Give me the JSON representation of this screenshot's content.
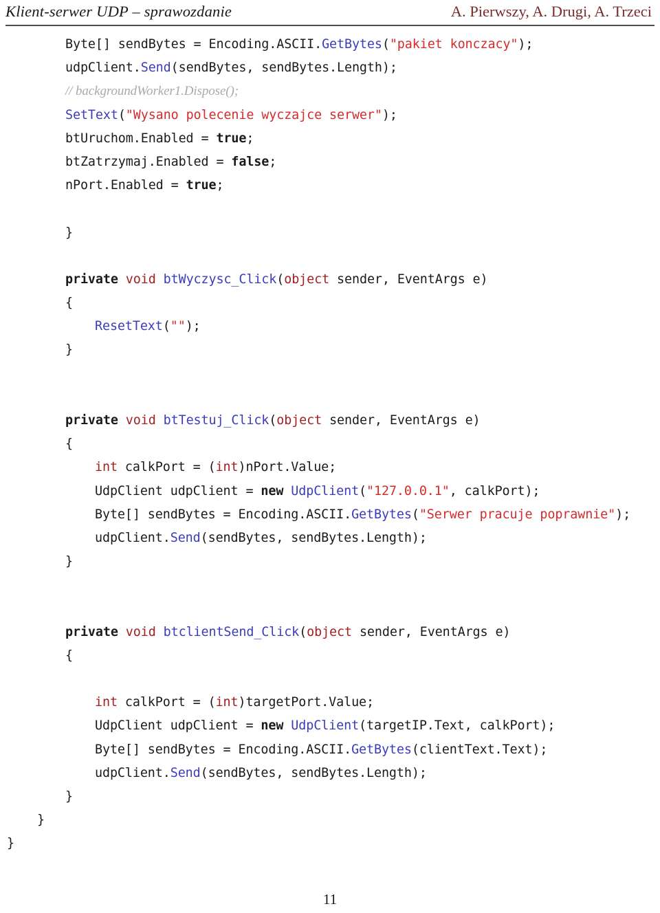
{
  "header": {
    "left_title": "Klient-serwer UDP – sprawozdanie",
    "right_authors": "A. Pierwszy, A. Drugi, A. Trzeci",
    "rule_color": "#4d4d4d",
    "authors_color": "#7a2b2b"
  },
  "footer": {
    "page_number": "11"
  },
  "colors": {
    "plain": "#1a1a1a",
    "keyword": "#1a1a1a",
    "type": "#a32020",
    "function": "#3b3bbd",
    "string": "#d42b2b",
    "comment": "#a9a9a9"
  },
  "code": {
    "lines": [
      {
        "indent": 2,
        "tokens": [
          {
            "t": "Byte[] sendBytes = Encoding.ASCII.",
            "c": "plain"
          },
          {
            "t": "GetBytes",
            "c": "function"
          },
          {
            "t": "(",
            "c": "plain"
          },
          {
            "t": "\"pakiet konczacy\"",
            "c": "string"
          },
          {
            "t": ");",
            "c": "plain"
          }
        ]
      },
      {
        "indent": 2,
        "tokens": [
          {
            "t": "udpClient.",
            "c": "plain"
          },
          {
            "t": "Send",
            "c": "function"
          },
          {
            "t": "(sendBytes, sendBytes.Length);",
            "c": "plain"
          }
        ]
      },
      {
        "indent": 2,
        "tokens": [
          {
            "t": "// backgroundWorker1.Dispose();",
            "c": "comment"
          }
        ]
      },
      {
        "indent": 2,
        "tokens": [
          {
            "t": "SetText",
            "c": "function"
          },
          {
            "t": "(",
            "c": "plain"
          },
          {
            "t": "\"Wysano polecenie wyczajce serwer\"",
            "c": "string"
          },
          {
            "t": ");",
            "c": "plain"
          }
        ]
      },
      {
        "indent": 2,
        "tokens": [
          {
            "t": "btUruchom.Enabled = ",
            "c": "plain"
          },
          {
            "t": "true",
            "c": "keyword"
          },
          {
            "t": ";",
            "c": "plain"
          }
        ]
      },
      {
        "indent": 2,
        "tokens": [
          {
            "t": "btZatrzymaj.Enabled = ",
            "c": "plain"
          },
          {
            "t": "false",
            "c": "keyword"
          },
          {
            "t": ";",
            "c": "plain"
          }
        ]
      },
      {
        "indent": 2,
        "tokens": [
          {
            "t": "nPort.Enabled = ",
            "c": "plain"
          },
          {
            "t": "true",
            "c": "keyword"
          },
          {
            "t": ";",
            "c": "plain"
          }
        ]
      },
      {
        "indent": 2,
        "tokens": [
          {
            "t": " ",
            "c": "plain"
          }
        ]
      },
      {
        "indent": 2,
        "tokens": [
          {
            "t": "}",
            "c": "plain"
          }
        ]
      },
      {
        "indent": 2,
        "tokens": [
          {
            "t": " ",
            "c": "plain"
          }
        ]
      },
      {
        "indent": 2,
        "tokens": [
          {
            "t": "private ",
            "c": "keyword"
          },
          {
            "t": "void",
            "c": "type"
          },
          {
            "t": " ",
            "c": "plain"
          },
          {
            "t": "btWyczysc_Click",
            "c": "function"
          },
          {
            "t": "(",
            "c": "plain"
          },
          {
            "t": "object",
            "c": "type"
          },
          {
            "t": " sender, EventArgs e)",
            "c": "plain"
          }
        ]
      },
      {
        "indent": 2,
        "tokens": [
          {
            "t": "{",
            "c": "plain"
          }
        ]
      },
      {
        "indent": 3,
        "tokens": [
          {
            "t": "ResetText",
            "c": "function"
          },
          {
            "t": "(",
            "c": "plain"
          },
          {
            "t": "\"\"",
            "c": "string"
          },
          {
            "t": ");",
            "c": "plain"
          }
        ]
      },
      {
        "indent": 2,
        "tokens": [
          {
            "t": "}",
            "c": "plain"
          }
        ]
      },
      {
        "indent": 2,
        "tokens": [
          {
            "t": " ",
            "c": "plain"
          }
        ]
      },
      {
        "indent": 2,
        "tokens": [
          {
            "t": " ",
            "c": "plain"
          }
        ]
      },
      {
        "indent": 2,
        "tokens": [
          {
            "t": "private ",
            "c": "keyword"
          },
          {
            "t": "void",
            "c": "type"
          },
          {
            "t": " ",
            "c": "plain"
          },
          {
            "t": "btTestuj_Click",
            "c": "function"
          },
          {
            "t": "(",
            "c": "plain"
          },
          {
            "t": "object",
            "c": "type"
          },
          {
            "t": " sender, EventArgs e)",
            "c": "plain"
          }
        ]
      },
      {
        "indent": 2,
        "tokens": [
          {
            "t": "{",
            "c": "plain"
          }
        ]
      },
      {
        "indent": 3,
        "tokens": [
          {
            "t": "int",
            "c": "type"
          },
          {
            "t": " calkPort = (",
            "c": "plain"
          },
          {
            "t": "int",
            "c": "type"
          },
          {
            "t": ")nPort.Value;",
            "c": "plain"
          }
        ]
      },
      {
        "indent": 3,
        "tokens": [
          {
            "t": "UdpClient udpClient = ",
            "c": "plain"
          },
          {
            "t": "new",
            "c": "keyword"
          },
          {
            "t": " ",
            "c": "plain"
          },
          {
            "t": "UdpClient",
            "c": "function"
          },
          {
            "t": "(",
            "c": "plain"
          },
          {
            "t": "\"127.0.0.1\"",
            "c": "string"
          },
          {
            "t": ", calkPort);",
            "c": "plain"
          }
        ]
      },
      {
        "indent": 3,
        "tokens": [
          {
            "t": "Byte[] sendBytes = Encoding.ASCII.",
            "c": "plain"
          },
          {
            "t": "GetBytes",
            "c": "function"
          },
          {
            "t": "(",
            "c": "plain"
          },
          {
            "t": "\"Serwer pracuje poprawnie\"",
            "c": "string"
          },
          {
            "t": ");",
            "c": "plain"
          }
        ]
      },
      {
        "indent": 3,
        "tokens": [
          {
            "t": "udpClient.",
            "c": "plain"
          },
          {
            "t": "Send",
            "c": "function"
          },
          {
            "t": "(sendBytes, sendBytes.Length);",
            "c": "plain"
          }
        ]
      },
      {
        "indent": 2,
        "tokens": [
          {
            "t": "}",
            "c": "plain"
          }
        ]
      },
      {
        "indent": 2,
        "tokens": [
          {
            "t": " ",
            "c": "plain"
          }
        ]
      },
      {
        "indent": 2,
        "tokens": [
          {
            "t": " ",
            "c": "plain"
          }
        ]
      },
      {
        "indent": 2,
        "tokens": [
          {
            "t": "private ",
            "c": "keyword"
          },
          {
            "t": "void",
            "c": "type"
          },
          {
            "t": " ",
            "c": "plain"
          },
          {
            "t": "btclientSend_Click",
            "c": "function"
          },
          {
            "t": "(",
            "c": "plain"
          },
          {
            "t": "object",
            "c": "type"
          },
          {
            "t": " sender, EventArgs e)",
            "c": "plain"
          }
        ]
      },
      {
        "indent": 2,
        "tokens": [
          {
            "t": "{",
            "c": "plain"
          }
        ]
      },
      {
        "indent": 2,
        "tokens": [
          {
            "t": " ",
            "c": "plain"
          }
        ]
      },
      {
        "indent": 3,
        "tokens": [
          {
            "t": "int",
            "c": "type"
          },
          {
            "t": " calkPort = (",
            "c": "plain"
          },
          {
            "t": "int",
            "c": "type"
          },
          {
            "t": ")targetPort.Value;",
            "c": "plain"
          }
        ]
      },
      {
        "indent": 3,
        "tokens": [
          {
            "t": "UdpClient udpClient = ",
            "c": "plain"
          },
          {
            "t": "new",
            "c": "keyword"
          },
          {
            "t": " ",
            "c": "plain"
          },
          {
            "t": "UdpClient",
            "c": "function"
          },
          {
            "t": "(targetIP.Text, calkPort);",
            "c": "plain"
          }
        ]
      },
      {
        "indent": 3,
        "tokens": [
          {
            "t": "Byte[] sendBytes = Encoding.ASCII.",
            "c": "plain"
          },
          {
            "t": "GetBytes",
            "c": "function"
          },
          {
            "t": "(clientText.Text);",
            "c": "plain"
          }
        ]
      },
      {
        "indent": 3,
        "tokens": [
          {
            "t": "udpClient.",
            "c": "plain"
          },
          {
            "t": "Send",
            "c": "function"
          },
          {
            "t": "(sendBytes, sendBytes.Length);",
            "c": "plain"
          }
        ]
      },
      {
        "indent": 2,
        "tokens": [
          {
            "t": "}",
            "c": "plain"
          }
        ]
      },
      {
        "indent": 1,
        "tokens": [
          {
            "t": "}",
            "c": "plain"
          }
        ]
      },
      {
        "indent": 0,
        "tokens": [
          {
            "t": "}",
            "c": "plain"
          }
        ]
      }
    ]
  }
}
